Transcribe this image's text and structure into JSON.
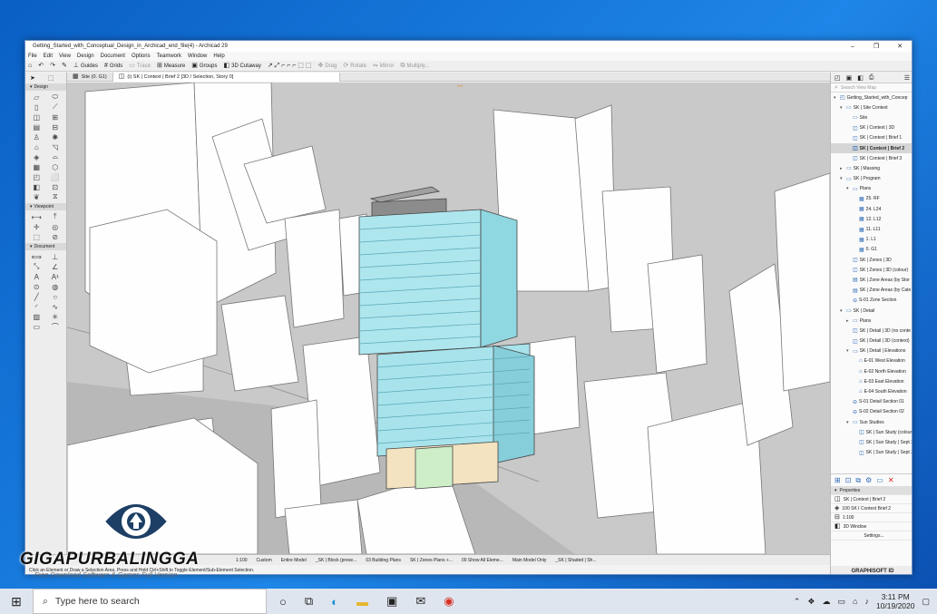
{
  "window": {
    "title": "Getting_Started_with_Conceptual_Design_in_Archicad_end_file(4) - Archicad 29",
    "minimize": "–",
    "maximize": "❐",
    "close": "✕"
  },
  "menu": [
    "File",
    "Edit",
    "View",
    "Design",
    "Document",
    "Options",
    "Teamwork",
    "Window",
    "Help"
  ],
  "toolbar": {
    "guides": "Guides",
    "grids": "Grids",
    "trace": "Trace",
    "measure": "Measure",
    "groups": "Groups",
    "cutaway": "3D Cutaway",
    "drag": "Drag",
    "rotate": "Rotate",
    "mirror": "Mirror",
    "multiply": "Multiply..."
  },
  "tabs": {
    "site": "Site (0. G1)",
    "active": "(i) SK | Context | Brief 2 [3D / Selection, Story 0]"
  },
  "toolbox": {
    "design_header": "Design",
    "viewpoint_header": "Viewpoint",
    "document_header": "Document"
  },
  "statusbar": {
    "scale": "1:100",
    "custom": "Custom",
    "model": "Entire Model",
    "block": "_SK | Block (prese...",
    "plans": "03 Building Plans",
    "zones": "SK | Zones Plans +...",
    "show": "00 Show All Eleme...",
    "main": "Main Model Only",
    "shaded": "_SK | Shaded | Sh..."
  },
  "hint": "Click an Element or Draw a Selection Area. Press and Hold Ctrl+Shift to Toggle Element/Sub-Element Selection.",
  "navigator": {
    "search_placeholder": "Search View Map",
    "tree": [
      {
        "label": "Getting_Started_with_Concep",
        "level": 0,
        "caret": "v",
        "icon": "proj"
      },
      {
        "label": "SK | Site Context",
        "level": 1,
        "caret": "v",
        "icon": "folder"
      },
      {
        "label": "Site",
        "level": 2,
        "caret": "",
        "icon": "folder"
      },
      {
        "label": "SK | Context | 3D",
        "level": 2,
        "caret": "",
        "icon": "view"
      },
      {
        "label": "SK | Context | Brief 1",
        "level": 2,
        "caret": "",
        "icon": "view"
      },
      {
        "label": "SK | Context | Brief 2",
        "level": 2,
        "caret": "",
        "icon": "view",
        "selected": true
      },
      {
        "label": "SK | Context | Brief 3",
        "level": 2,
        "caret": "",
        "icon": "view"
      },
      {
        "label": "SK | Massing",
        "level": 1,
        "caret": ">",
        "icon": "folder"
      },
      {
        "label": "SK | Program",
        "level": 1,
        "caret": "v",
        "icon": "folder"
      },
      {
        "label": "Plans",
        "level": 2,
        "caret": "v",
        "icon": "folder"
      },
      {
        "label": "25. RF",
        "level": 3,
        "caret": "",
        "icon": "plan"
      },
      {
        "label": "24. L24",
        "level": 3,
        "caret": "",
        "icon": "plan"
      },
      {
        "label": "12. L12",
        "level": 3,
        "caret": "",
        "icon": "plan"
      },
      {
        "label": "11. L11",
        "level": 3,
        "caret": "",
        "icon": "plan"
      },
      {
        "label": "1. L1",
        "level": 3,
        "caret": "",
        "icon": "plan"
      },
      {
        "label": "0. G1",
        "level": 3,
        "caret": "",
        "icon": "plan"
      },
      {
        "label": "SK | Zones | 3D",
        "level": 2,
        "caret": "",
        "icon": "view"
      },
      {
        "label": "SK | Zones | 3D (colour)",
        "level": 2,
        "caret": "",
        "icon": "view"
      },
      {
        "label": "SK | Zone Areas (by Stor",
        "level": 2,
        "caret": "",
        "icon": "table"
      },
      {
        "label": "SK | Zone Areas (by Cate",
        "level": 2,
        "caret": "",
        "icon": "table"
      },
      {
        "label": "S-01 Zone Section",
        "level": 2,
        "caret": "",
        "icon": "section"
      },
      {
        "label": "SK | Detail",
        "level": 1,
        "caret": "v",
        "icon": "folder"
      },
      {
        "label": "Plans",
        "level": 2,
        "caret": ">",
        "icon": "folder"
      },
      {
        "label": "SK | Detail | 3D (no conte",
        "level": 2,
        "caret": "",
        "icon": "view"
      },
      {
        "label": "SK | Detail | 3D (context)",
        "level": 2,
        "caret": "",
        "icon": "view"
      },
      {
        "label": "SK | Detail | Elevations",
        "level": 2,
        "caret": "v",
        "icon": "folder"
      },
      {
        "label": "E-01 West Elevation",
        "level": 3,
        "caret": "",
        "icon": "elev"
      },
      {
        "label": "E-02 North Elevation",
        "level": 3,
        "caret": "",
        "icon": "elev"
      },
      {
        "label": "E-03 East Elevation",
        "level": 3,
        "caret": "",
        "icon": "elev"
      },
      {
        "label": "E-04 South Elevation",
        "level": 3,
        "caret": "",
        "icon": "elev"
      },
      {
        "label": "S-01 Detail Section 01",
        "level": 2,
        "caret": "",
        "icon": "section"
      },
      {
        "label": "S-02 Detail Section 02",
        "level": 2,
        "caret": "",
        "icon": "section"
      },
      {
        "label": "Sun Studies",
        "level": 2,
        "caret": "v",
        "icon": "folder"
      },
      {
        "label": "SK | Sun Study (colour)",
        "level": 3,
        "caret": "",
        "icon": "view"
      },
      {
        "label": "SK | Sun Study | Sept 2",
        "level": 3,
        "caret": "",
        "icon": "view"
      },
      {
        "label": "SK | Sun Study | Sept 2",
        "level": 3,
        "caret": "",
        "icon": "view"
      }
    ],
    "properties_header": "Properties",
    "prop_name": "SK | Context | Brief 2",
    "prop_id": "100 SK I Context Brief 2",
    "prop_scale": "1:100",
    "prop_window": "3D Window",
    "settings": "Settings...",
    "brand": "GRAPHISOFT ID"
  },
  "watermark": {
    "brand": "GIGAPURBALINGGA",
    "sub": "Free Download Software & Games Full Version"
  },
  "taskbar": {
    "search_placeholder": "Type here to search",
    "time": "3:11 PM",
    "date": "10/19/2020"
  }
}
